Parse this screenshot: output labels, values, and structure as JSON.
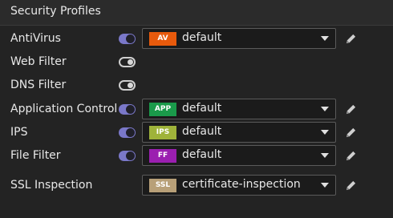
{
  "section": {
    "title": "Security Profiles"
  },
  "rows": [
    {
      "label": "AntiVirus",
      "enabled": true,
      "badge": "AV",
      "badge_color": "#e85a0c",
      "value": "default"
    },
    {
      "label": "Web Filter",
      "enabled": false
    },
    {
      "label": "DNS Filter",
      "enabled": false
    },
    {
      "label": "Application Control",
      "enabled": true,
      "badge": "APP",
      "badge_color": "#1a9a4a",
      "value": "default"
    },
    {
      "label": "IPS",
      "enabled": true,
      "badge": "IPS",
      "badge_color": "#9fb33a",
      "value": "default"
    },
    {
      "label": "File Filter",
      "enabled": true,
      "badge": "FF",
      "badge_color": "#9b1fb0",
      "value": "default"
    },
    {
      "label": "SSL Inspection",
      "badge": "SSL",
      "badge_color": "#b8a078",
      "value": "certificate-inspection"
    }
  ],
  "icons": {
    "edit": "pencil-icon",
    "dropdown": "chevron-down-icon"
  }
}
